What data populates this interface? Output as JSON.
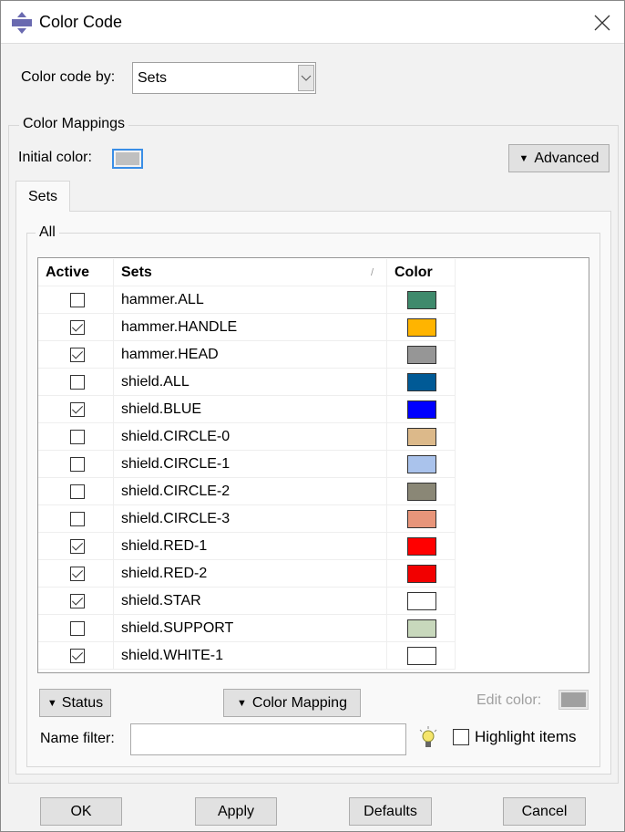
{
  "window": {
    "title": "Color Code",
    "icon": "abaqus-logo-icon",
    "close_icon": "close-icon"
  },
  "color_code_by": {
    "label": "Color code by:",
    "value": "Sets"
  },
  "color_mappings": {
    "legend": "Color Mappings",
    "initial_color_label": "Initial color:",
    "initial_color": "#c0c0c0",
    "advanced_label": "Advanced"
  },
  "tabs": [
    {
      "label": "Sets",
      "active": true
    }
  ],
  "group": {
    "legend": "All"
  },
  "table": {
    "columns": [
      "Active",
      "Sets",
      "Color"
    ],
    "sort_indicator": "/",
    "rows": [
      {
        "active": false,
        "name": "hammer.ALL",
        "color": "#3f8a6c"
      },
      {
        "active": true,
        "name": "hammer.HANDLE",
        "color": "#ffb400"
      },
      {
        "active": true,
        "name": "hammer.HEAD",
        "color": "#969696"
      },
      {
        "active": false,
        "name": "shield.ALL",
        "color": "#005a96"
      },
      {
        "active": true,
        "name": "shield.BLUE",
        "color": "#0000ff"
      },
      {
        "active": false,
        "name": "shield.CIRCLE-0",
        "color": "#dcb98a"
      },
      {
        "active": false,
        "name": "shield.CIRCLE-1",
        "color": "#aac3ec"
      },
      {
        "active": false,
        "name": "shield.CIRCLE-2",
        "color": "#8a8776"
      },
      {
        "active": false,
        "name": "shield.CIRCLE-3",
        "color": "#e8957a"
      },
      {
        "active": true,
        "name": "shield.RED-1",
        "color": "#ff0000"
      },
      {
        "active": true,
        "name": "shield.RED-2",
        "color": "#f20000"
      },
      {
        "active": true,
        "name": "shield.STAR",
        "color": "#ffffff"
      },
      {
        "active": false,
        "name": "shield.SUPPORT",
        "color": "#c8d8bc"
      },
      {
        "active": true,
        "name": "shield.WHITE-1",
        "color": "#ffffff"
      }
    ]
  },
  "controls": {
    "status_label": "Status",
    "color_mapping_label": "Color Mapping",
    "edit_color_label": "Edit color:",
    "edit_color": "#a0a0a0",
    "name_filter_label": "Name filter:",
    "name_filter_value": "",
    "highlight_label": "Highlight items",
    "highlight_checked": false
  },
  "footer": {
    "ok": "OK",
    "apply": "Apply",
    "defaults": "Defaults",
    "cancel": "Cancel"
  }
}
